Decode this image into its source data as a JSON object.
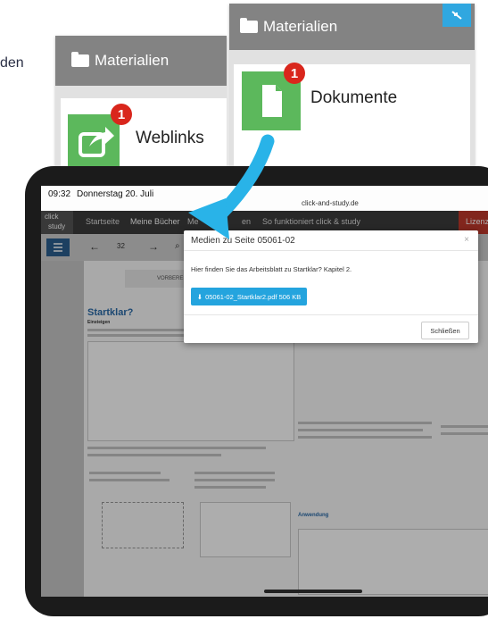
{
  "cropped_left_text": "den",
  "panel_back": {
    "header_label": "Materialien",
    "card_label": "Dokumente",
    "badge_count": "1"
  },
  "panel_front": {
    "header_label": "Materialien",
    "card_label": "Weblinks",
    "badge_count": "1"
  },
  "tablet": {
    "status_time": "09:32",
    "status_date": "Donnerstag 20. Juli",
    "url": "click-and-study.de",
    "logo_line1": "click",
    "logo_line2": "study",
    "nav": [
      "Startseite",
      "Meine Bücher",
      "Me",
      "en",
      "So funktioniert click & study",
      "Lizenz lö"
    ],
    "page_number": "32",
    "doc_tag": "VORBEREITUNG",
    "doc_title": "Startklar?",
    "doc_section": "Einsteigen",
    "doc_heading2": "Anwendung",
    "modal": {
      "title": "Medien zu Seite 05061-02",
      "title_visible": "Medien",
      "title_visible_2": "te 05061-02",
      "close_x": "×",
      "body": "Hier finden Sie das Arbeitsblatt zu Startklar? Kapitel 2.",
      "download_label": "05061-02_Startklar2.pdf 506 KB",
      "close_label": "Schließen"
    }
  },
  "colors": {
    "green": "#5cb85c",
    "badge_red": "#d9261c",
    "accent_blue": "#24a4de",
    "panel_header_grey": "#838383"
  },
  "icons": [
    "folder-icon",
    "document-icon",
    "share-icon",
    "expand-icon",
    "download-icon",
    "curved-arrow-icon"
  ]
}
